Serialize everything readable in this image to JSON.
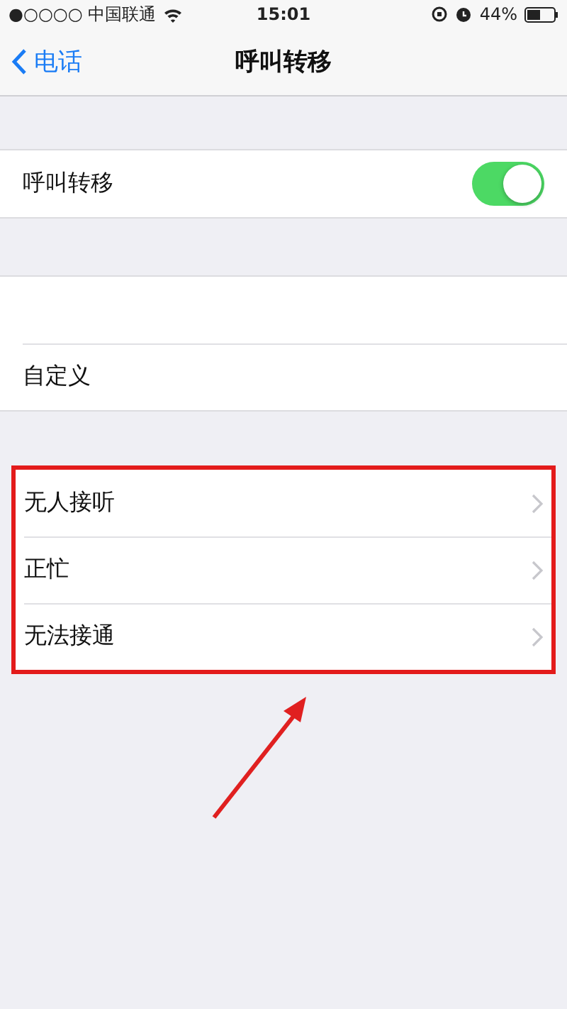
{
  "status_bar": {
    "carrier": "●○○○○ 中国联通",
    "time": "15:01",
    "battery": "44%"
  },
  "nav": {
    "back": "电话",
    "title": "呼叫转移"
  },
  "toggle_row": {
    "label": "呼叫转移",
    "on": true
  },
  "options": [
    {
      "label": "自定义"
    }
  ],
  "conditions": [
    {
      "label": "无人接听"
    },
    {
      "label": "正忙"
    },
    {
      "label": "无法接通"
    }
  ]
}
